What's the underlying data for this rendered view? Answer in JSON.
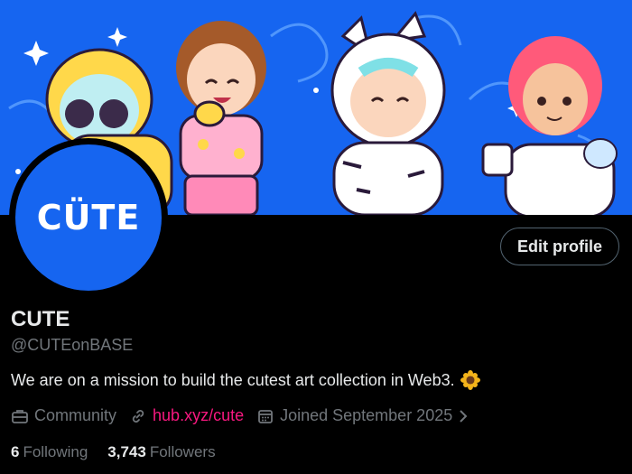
{
  "banner": {
    "background": "#1665f0"
  },
  "avatar": {
    "text": "CÜTE",
    "background": "#1665f0"
  },
  "edit_profile_label": "Edit profile",
  "profile": {
    "name": "CUTE",
    "handle": "@CUTEonBASE",
    "bio": "We are on a mission to build the cutest art collection in Web3.",
    "bio_emoji": "sunflower-icon"
  },
  "meta": {
    "category": "Community",
    "link": "hub.xyz/cute",
    "joined": "Joined September 2025",
    "link_color": "#f91880"
  },
  "stats": {
    "following_count": "6",
    "following_label": "Following",
    "followers_count": "3,743",
    "followers_label": "Followers"
  }
}
